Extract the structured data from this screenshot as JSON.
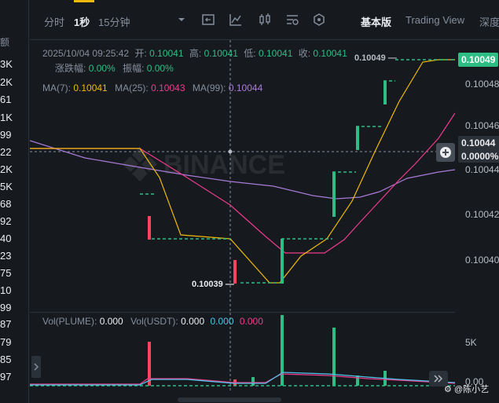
{
  "left_strip": {
    "header": "额",
    "values": [
      "3K",
      "2K",
      "61",
      "1K",
      "99",
      "22",
      "2K",
      "5K",
      "68",
      "92",
      "40",
      "23",
      "75",
      "10",
      "99",
      "87",
      "79",
      "85",
      "97"
    ]
  },
  "toolbar": {
    "time": "分时",
    "interval_1s": "1秒",
    "interval_15m": "15分钟",
    "view_basic": "基本版",
    "view_tradingview": "Trading View",
    "view_depth": "深度"
  },
  "ohlc": {
    "datetime": "2025/10/04 09:25:42",
    "open_label": "开:",
    "open": "0.10041",
    "high_label": "高:",
    "high": "0.10041",
    "low_label": "低:",
    "low": "0.10041",
    "close_label": "收:",
    "close": "0.10041",
    "change_label": "涨跌幅:",
    "change": "0.00%",
    "amplitude_label": "振幅:",
    "amplitude": "0.00%"
  },
  "ma": {
    "ma7_label": "MA(7):",
    "ma7": "0.10041",
    "ma25_label": "MA(25):",
    "ma25": "0.10043",
    "ma99_label": "MA(99):",
    "ma99": "0.10044"
  },
  "volume": {
    "plume_label": "Vol(PLUME):",
    "plume": "0.000",
    "usdt_label": "Vol(USDT):",
    "usdt": "0.000",
    "v2": "0.000",
    "v3": "0.000"
  },
  "y_axis": {
    "labels": [
      "0.10048",
      "0.10046",
      "0.10044",
      "0.10042",
      "0.10040"
    ],
    "vol_labels": [
      "5K",
      "0.00"
    ],
    "current_price": "0.10049",
    "crosshair_price": "0.10044",
    "crosshair_pct": "0.0000%"
  },
  "annotations": {
    "high_marker": "0.10049",
    "low_marker": "0.10039"
  },
  "watermark": "BINANCE",
  "footer": {
    "user": "@陈小艺"
  },
  "colors": {
    "up": "#2ebd85",
    "down": "#f6465d",
    "ma7": "#f0b90b",
    "ma25": "#ee3b8c",
    "ma99": "#a97bd8",
    "usdt_line": "#4dc3e8"
  },
  "chart_data": {
    "type": "candlestick",
    "y_range": [
      0.10038,
      0.1005
    ],
    "candles": [
      {
        "o": 0.10042,
        "c": 0.10042
      },
      {
        "o": 0.10041,
        "c": 0.10041
      },
      {
        "o": 0.1004,
        "c": 0.10039
      },
      {
        "o": 0.10039,
        "c": 0.10041
      },
      {
        "o": 0.10041,
        "c": 0.10044
      },
      {
        "o": 0.10045,
        "c": 0.10045
      },
      {
        "o": 0.10047,
        "c": 0.10047
      },
      {
        "o": 0.10049,
        "c": 0.10049
      }
    ],
    "volumes": [
      0,
      4000,
      0,
      600,
      4800,
      3600,
      1400,
      100
    ]
  }
}
